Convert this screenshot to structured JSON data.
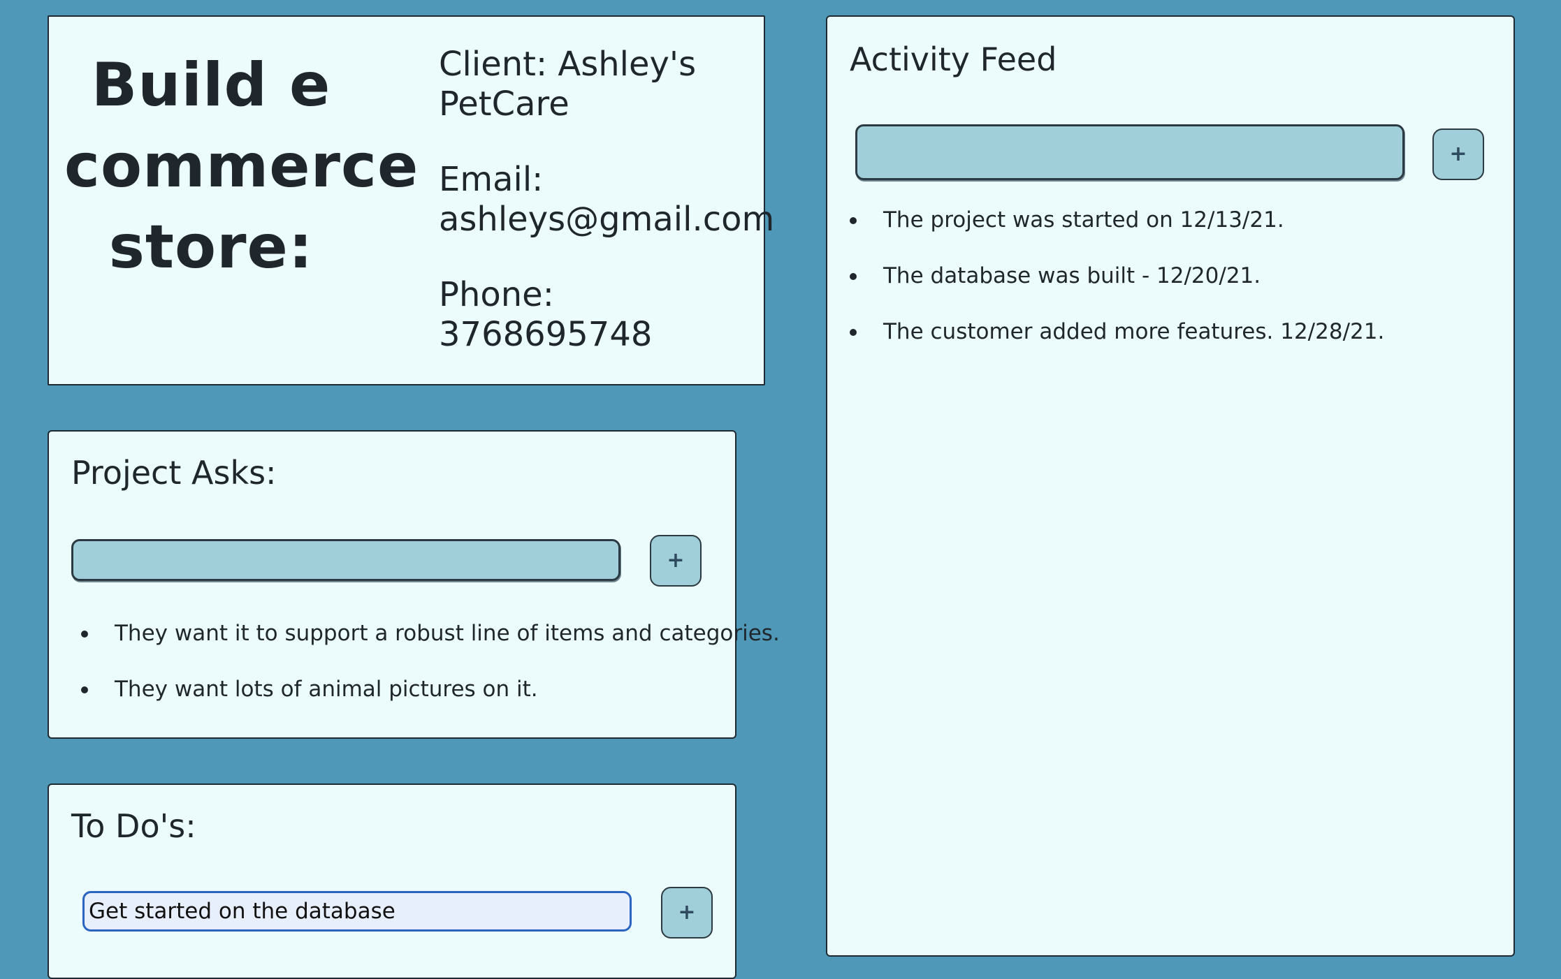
{
  "project": {
    "title": "Build e commerce store:",
    "client": "Client: Ashley's PetCare",
    "email": "Email: ashleys@gmail.com",
    "phone": "Phone: 3768695748"
  },
  "project_asks": {
    "title": "Project Asks:",
    "input_value": "",
    "add_label": "+",
    "items": [
      "They want it to support a robust line of items and categories.",
      "They want lots of animal pictures on it."
    ]
  },
  "todos": {
    "title": "To Do's:",
    "input_value": "Get started on the database",
    "add_label": "+"
  },
  "activity": {
    "title": "Activity Feed",
    "input_value": "",
    "add_label": "+",
    "items": [
      "The project was started on 12/13/21.",
      "The database was built - 12/20/21.",
      "The customer added more features. 12/28/21."
    ]
  },
  "colors": {
    "background": "#4f98b7",
    "card": "#ecfcfc",
    "input": "#a0ced9",
    "focus": "#2b64c0"
  }
}
